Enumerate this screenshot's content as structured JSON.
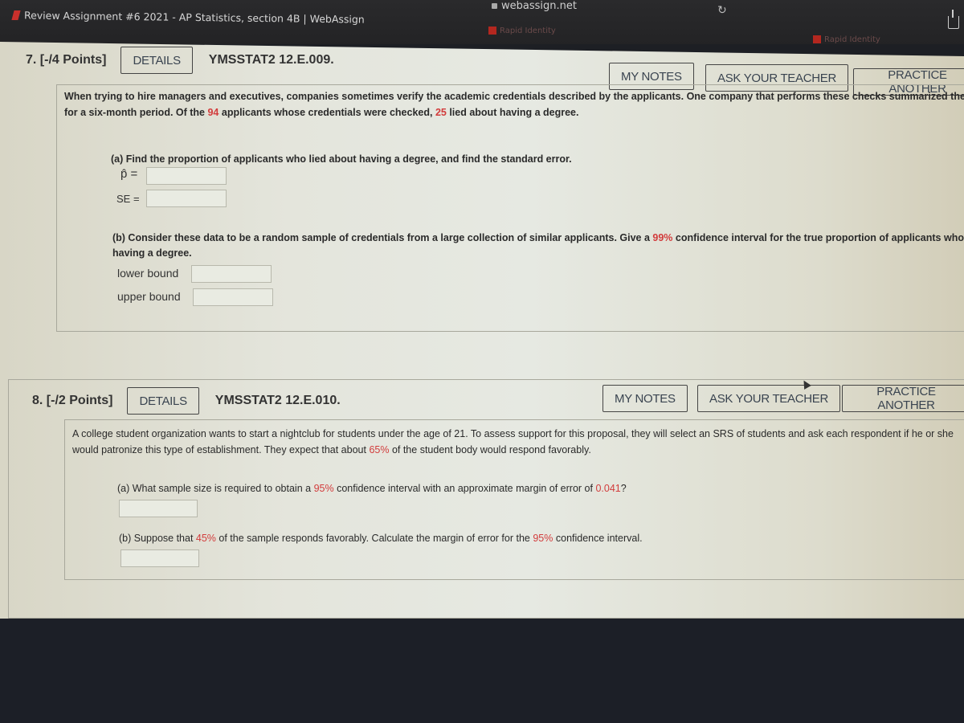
{
  "browser": {
    "tab_title": "Review Assignment #6 2021 - AP Statistics, section 4B | WebAssign",
    "url": "webassign.net",
    "bookmarks": [
      "Rapid Identity",
      "Rapid Identity"
    ]
  },
  "questions": [
    {
      "number": "7.",
      "points": "[-/4 Points]",
      "details_label": "DETAILS",
      "code": "YMSSTAT2 12.E.009.",
      "my_notes_label": "MY NOTES",
      "ask_teacher_label": "ASK YOUR TEACHER",
      "practice_label": "PRACTICE ANOTHER",
      "intro": {
        "line1": "When trying to hire managers and executives, companies sometimes verify the academic credentials described by the applicants. One company that performs these checks summarized their findings",
        "line2_pre": "for a six-month period. Of the ",
        "n_total": "94",
        "line2_mid": " applicants whose credentials were checked, ",
        "n_lied": "25",
        "line2_post": " lied about having a degree."
      },
      "part_a": {
        "prompt": "(a) Find the proportion of applicants who lied about having a degree, and find the standard error.",
        "phat_label": "p̂ =",
        "phat_value": "",
        "se_label": "SE =",
        "se_value": ""
      },
      "part_b": {
        "prompt_pre": "(b) Consider these data to be a random sample of credentials from a large collection of similar applicants. Give a ",
        "confidence": "99%",
        "prompt_post": " confidence interval for the true proportion of applicants who lie about",
        "prompt_line2": "having a degree.",
        "lower_label": "lower bound",
        "lower_value": "",
        "upper_label": "upper bound",
        "upper_value": ""
      }
    },
    {
      "number": "8.",
      "points": "[-/2 Points]",
      "details_label": "DETAILS",
      "code": "YMSSTAT2 12.E.010.",
      "my_notes_label": "MY NOTES",
      "ask_teacher_label": "ASK YOUR TEACHER",
      "practice_label": "PRACTICE ANOTHER",
      "intro": {
        "line1": "A college student organization wants to start a nightclub for students under the age of 21. To assess support for this proposal, they will select an SRS of students and ask each respondent if he or she",
        "line2_pre": "would patronize this type of establishment. They expect that about ",
        "expected_pct": "65%",
        "line2_post": " of the student body would respond favorably."
      },
      "part_a": {
        "prompt_pre": "(a) What sample size is required to obtain a ",
        "confidence": "95%",
        "prompt_mid": " confidence interval with an approximate margin of error of ",
        "margin": "0.041",
        "prompt_post": "?",
        "answer_value": ""
      },
      "part_b": {
        "prompt_pre": "(b) Suppose that ",
        "sample_pct": "45%",
        "prompt_mid": " of the sample responds favorably. Calculate the margin of error for the ",
        "confidence": "95%",
        "prompt_post": " confidence interval.",
        "answer_value": ""
      }
    }
  ]
}
